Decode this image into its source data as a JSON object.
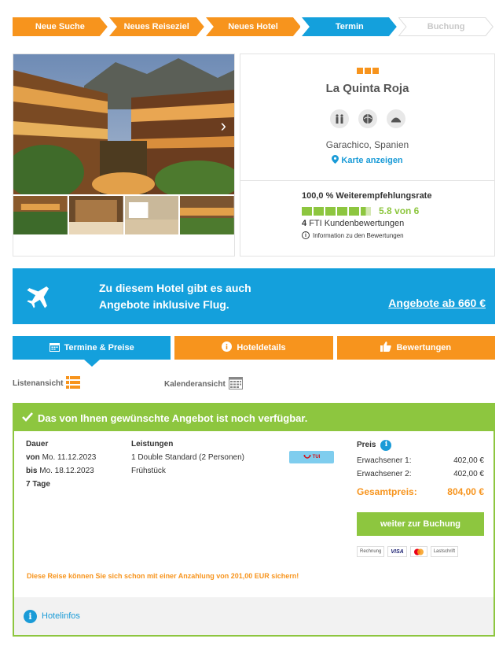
{
  "steps": [
    {
      "label": "Neue Suche",
      "state": "done"
    },
    {
      "label": "Neues Reiseziel",
      "state": "done"
    },
    {
      "label": "Neues Hotel",
      "state": "done"
    },
    {
      "label": "Termin",
      "state": "current"
    },
    {
      "label": "Buchung",
      "state": "todo"
    }
  ],
  "colors": {
    "orange": "#f7941d",
    "blue": "#14a0dc",
    "green": "#8dc63f",
    "grey": "#f2f2f2"
  },
  "hotel": {
    "name": "La Quinta Roja",
    "stars": 3,
    "location": "Garachico, Spanien",
    "map_link": "Karte anzeigen",
    "amenities": [
      "family-icon",
      "beach-icon",
      "food-icon"
    ]
  },
  "rating": {
    "title": "100,0 % Weiterempfehlungsrate",
    "score": "5.8 von 6",
    "score_value": 5.8,
    "count": "4",
    "count_label": "FTI Kundenbewertungen",
    "info": "Information zu den Bewertungen"
  },
  "banner": {
    "line1": "Zu diesem Hotel gibt es auch",
    "line2": "Angebote inklusive Flug.",
    "link": "Angebote ab 660 €"
  },
  "tabs": [
    {
      "label": "Termine & Preise",
      "icon": "calendar-icon",
      "active": true
    },
    {
      "label": "Hoteldetails",
      "icon": "info-icon",
      "active": false
    },
    {
      "label": "Bewertungen",
      "icon": "thumbs-up-icon",
      "active": false
    }
  ],
  "views": {
    "list": "Listenansicht",
    "calendar": "Kalenderansicht"
  },
  "offer": {
    "header": "Das von Ihnen gewünschte Angebot ist noch verfügbar.",
    "duration_label": "Dauer",
    "from_label": "von",
    "from_date": "Mo. 11.12.2023",
    "to_label": "bis",
    "to_date": "Mo. 18.12.2023",
    "days": "7 Tage",
    "services_label": "Leistungen",
    "room": "1 Double Standard (2 Personen)",
    "board": "Frühstück",
    "operator": "TUI",
    "price_label": "Preis",
    "adult1_label": "Erwachsener 1:",
    "adult1_price": "402,00 €",
    "adult2_label": "Erwachsener 2:",
    "adult2_price": "402,00 €",
    "total_label": "Gesamtpreis:",
    "total_price": "804,00 €",
    "book_button": "weiter zur Buchung",
    "payments": [
      "Rechnung",
      "VISA",
      "",
      "Lastschrift"
    ],
    "deposit": "Diese Reise können Sie sich schon mit einer Anzahlung von 201,00 EUR sichern!",
    "footer_link": "Hotelinfos"
  }
}
